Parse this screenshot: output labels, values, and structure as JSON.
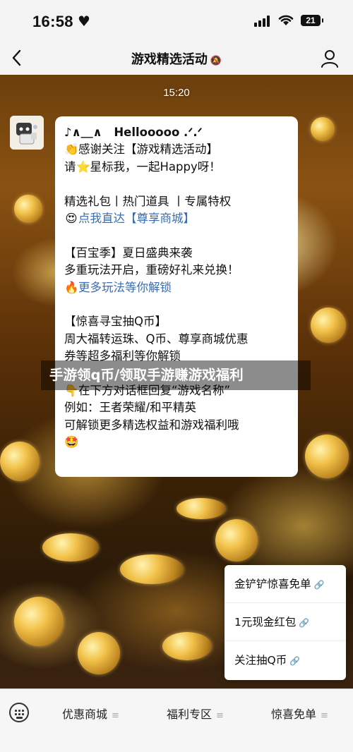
{
  "status": {
    "time": "16:58",
    "battery": "21"
  },
  "nav": {
    "title": "游戏精选活动"
  },
  "chat": {
    "timestamp": "15:20",
    "message_lines": [
      "♪∧＿∧　Hellooooo .ᐟ.ᐟ",
      "感谢关注【游戏精选活动】",
      "请⭐星标我，一起Happy呀！",
      "",
      "精选礼包丨热门道具 丨专属特权",
      "点我直达【尊享商城】",
      "",
      "【百宝季】夏日盛典来袭",
      "多重玩法开启，重磅好礼来兑换！",
      "更多玩法等你解锁",
      "",
      "【惊喜寻宝抽Q币】",
      "周大福转运珠、Q币、尊享商城优惠",
      "券等超多福利等你解锁",
      "",
      "在下方对话框回复“游戏名称”",
      "例如：王者荣耀/和平精英",
      "可解锁更多精选权益和游戏福利哦"
    ],
    "line2_prefix": "👏",
    "line2_text": "感谢关注【游戏精选活动】",
    "line3_a": "请",
    "line3_star": "⭐",
    "line3_b": "星标我，一起Happy呀！",
    "line6_emoji": "😍",
    "line6_link": "点我直达【尊享商城】",
    "line10_emoji": "🔥",
    "line10_link": "更多玩法等你解锁",
    "line16_emoji": "👇",
    "line16_text": "在下方对话框回复“游戏名称”",
    "final_emoji": "🤩"
  },
  "watermark": "手游领q币/领取手游赚游戏福利",
  "menu_popup": {
    "items": [
      "金铲铲惊喜免单",
      "1元现金红包",
      "关注抽Q币"
    ]
  },
  "bottom_tabs": [
    "优惠商城",
    "福利专区",
    "惊喜免单"
  ],
  "colors": {
    "link": "#3b6cb0",
    "bar_bg": "#f3f3f3"
  }
}
